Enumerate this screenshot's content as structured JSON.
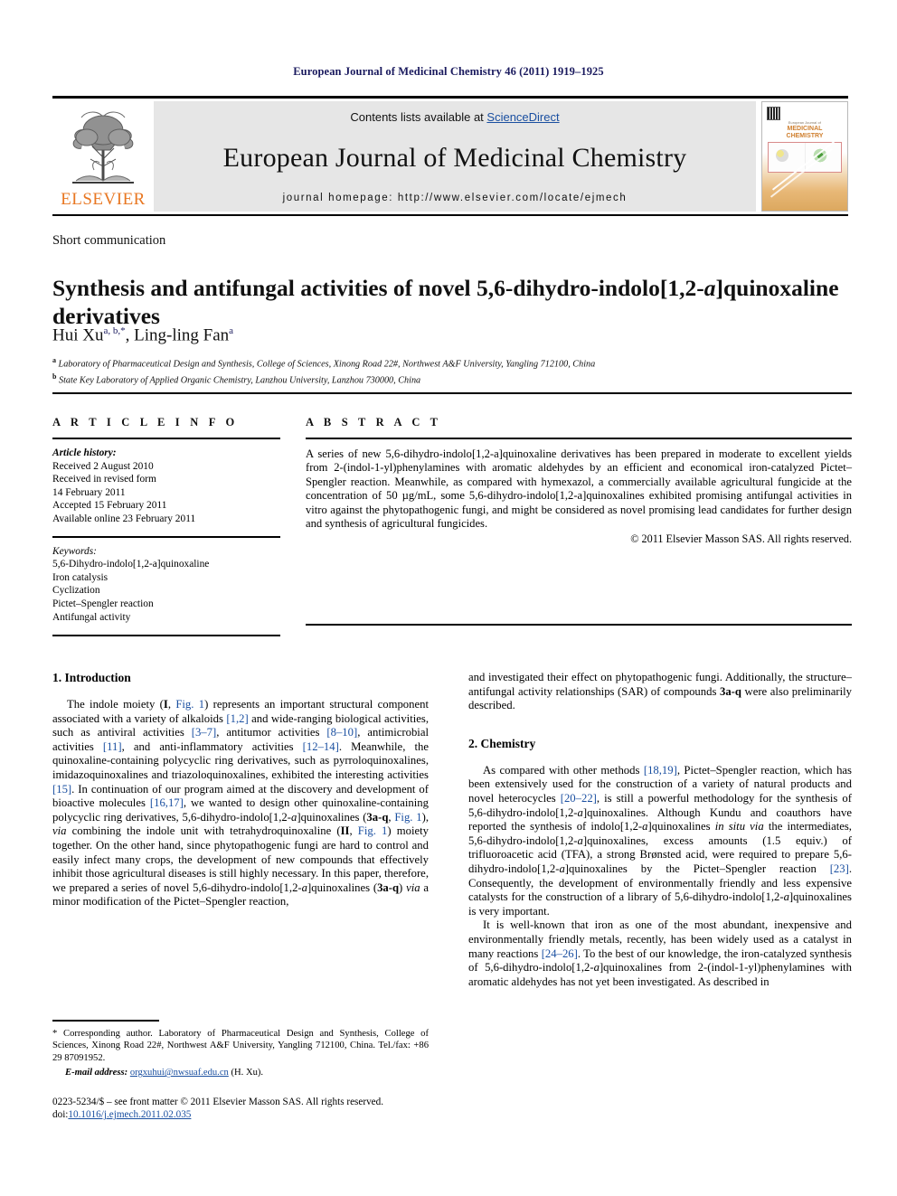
{
  "running_head": "European Journal of Medicinal Chemistry 46 (2011) 1919–1925",
  "banner": {
    "contents_prefix": "Contents lists available at ",
    "sciencedirect": "ScienceDirect",
    "journal_title": "European Journal of Medicinal Chemistry",
    "homepage": "journal homepage: http://www.elsevier.com/locate/ejmech",
    "publisher_wordmark": "ELSEVIER",
    "publisher_logo_icon": "elsevier-tree-icon",
    "cover": {
      "small_header": "European Journal of",
      "line1": "MEDICINAL",
      "line2": "CHEMISTRY",
      "barcode_icon": "barcode-icon"
    },
    "accent_orange": "#E87722",
    "link_blue": "#1a4fa0",
    "banner_bg": "#e6e6e6"
  },
  "article": {
    "doctype": "Short communication",
    "title": "Synthesis and antifungal activities of novel 5,6-dihydro-indolo[1,2-a]quinoxaline derivatives",
    "title_italic_fragment": "a",
    "authors_plain": "Hui Xu",
    "author1": "Hui Xu",
    "author1_sup": "a, b,*",
    "author2": "Ling-ling Fan",
    "author2_sup": "a",
    "affiliation_a_sup": "a",
    "affiliation_a": "Laboratory of Pharmaceutical Design and Synthesis, College of Sciences, Xinong Road 22#, Northwest A&F University, Yangling 712100, China",
    "affiliation_b_sup": "b",
    "affiliation_b": "State Key Laboratory of Applied Organic Chemistry, Lanzhou University, Lanzhou 730000, China"
  },
  "article_info": {
    "heading": "A R T I C L E   I N F O",
    "history_label": "Article history:",
    "history": [
      "Received 2 August 2010",
      "Received in revised form",
      "14 February 2011",
      "Accepted 15 February 2011",
      "Available online 23 February 2011"
    ],
    "keywords_label": "Keywords:",
    "keywords": [
      "5,6-Dihydro-indolo[1,2-a]quinoxaline",
      "Iron catalysis",
      "Cyclization",
      "Pictet–Spengler reaction",
      "Antifungal activity"
    ]
  },
  "abstract": {
    "heading": "A B S T R A C T",
    "text": "A series of new 5,6-dihydro-indolo[1,2-a]quinoxaline derivatives has been prepared in moderate to excellent yields from 2-(indol-1-yl)phenylamines with aromatic aldehydes by an efficient and economical iron-catalyzed Pictet–Spengler reaction. Meanwhile, as compared with hymexazol, a commercially available agricultural fungicide at the concentration of 50 µg/mL, some 5,6-dihydro-indolo[1,2-a]quinoxalines exhibited promising antifungal activities in vitro against the phytopathogenic fungi, and might be considered as novel promising lead candidates for further design and synthesis of agricultural fungicides.",
    "copyright": "© 2011 Elsevier Masson SAS. All rights reserved."
  },
  "sections": {
    "introduction_heading": "1. Introduction",
    "chemistry_heading": "2. Chemistry",
    "intro_paragraph": "The indole moiety (I, Fig. 1) represents an important structural component associated with a variety of alkaloids [1,2] and wide-ranging biological activities, such as antiviral activities [3–7], antitumor activities [8–10], antimicrobial activities [11], and anti-inflammatory activities [12–14]. Meanwhile, the quinoxaline-containing polycyclic ring derivatives, such as pyrroloquinoxalines, imidazoquinoxalines and triazoloquinoxalines, exhibited the interesting activities [15]. In continuation of our program aimed at the discovery and development of bioactive molecules [16,17], we wanted to design other quinoxaline-containing polycyclic ring derivatives, 5,6-dihydro-indolo[1,2-a]quinoxalines (3a-q, Fig. 1), via combining the indole unit with tetrahydroquinoxaline (II, Fig. 1) moiety together. On the other hand, since phytopathogenic fungi are hard to control and easily infect many crops, the development of new compounds that effectively inhibit those agricultural diseases is still highly necessary. In this paper, therefore, we prepared a series of novel 5,6-dihydro-indolo[1,2-a]quinoxalines (3a-q) via a minor modification of the Pictet–Spengler reaction, and investigated their effect on phytopathogenic fungi. Additionally, the structure–antifungal activity relationships (SAR) of compounds 3a-q were also preliminarily described.",
    "chemistry_paragraph_1": "As compared with other methods [18,19], Pictet–Spengler reaction, which has been extensively used for the construction of a variety of natural products and novel heterocycles [20–22], is still a powerful methodology for the synthesis of 5,6-dihydro-indolo[1,2-a]quinoxalines. Although Kundu and coauthors have reported the synthesis of indolo[1,2-a]quinoxalines in situ via the intermediates, 5,6-dihydro-indolo[1,2-a]quinoxalines, excess amounts (1.5 equiv.) of trifluoroacetic acid (TFA), a strong Brønsted acid, were required to prepare 5,6-dihydro-indolo[1,2-a]quinoxalines by the Pictet–Spengler reaction [23]. Consequently, the development of environmentally friendly and less expensive catalysts for the construction of a library of 5,6-dihydro-indolo[1,2-a]quinoxalines is very important.",
    "chemistry_paragraph_2": "It is well-known that iron as one of the most abundant, inexpensive and environmentally friendly metals, recently, has been widely used as a catalyst in many reactions [24–26]. To the best of our knowledge, the iron-catalyzed synthesis of 5,6-dihydro-indolo[1,2-a]quinoxalines from 2-(indol-1-yl)phenylamines with aromatic aldehydes has not yet been investigated. As described in"
  },
  "footnote": {
    "corresponding": "* Corresponding author. Laboratory of Pharmaceutical Design and Synthesis, College of Sciences, Xinong Road 22#, Northwest A&F University, Yangling 712100, China. Tel./fax: +86 29 87091952.",
    "email_label": "E-mail address:",
    "email": "orgxuhui@nwsuaf.edu.cn",
    "email_suffix": " (H. Xu)."
  },
  "footer": {
    "issn_line": "0223-5234/$ – see front matter © 2011 Elsevier Masson SAS. All rights reserved.",
    "doi_label": "doi:",
    "doi": "10.1016/j.ejmech.2011.02.035"
  }
}
